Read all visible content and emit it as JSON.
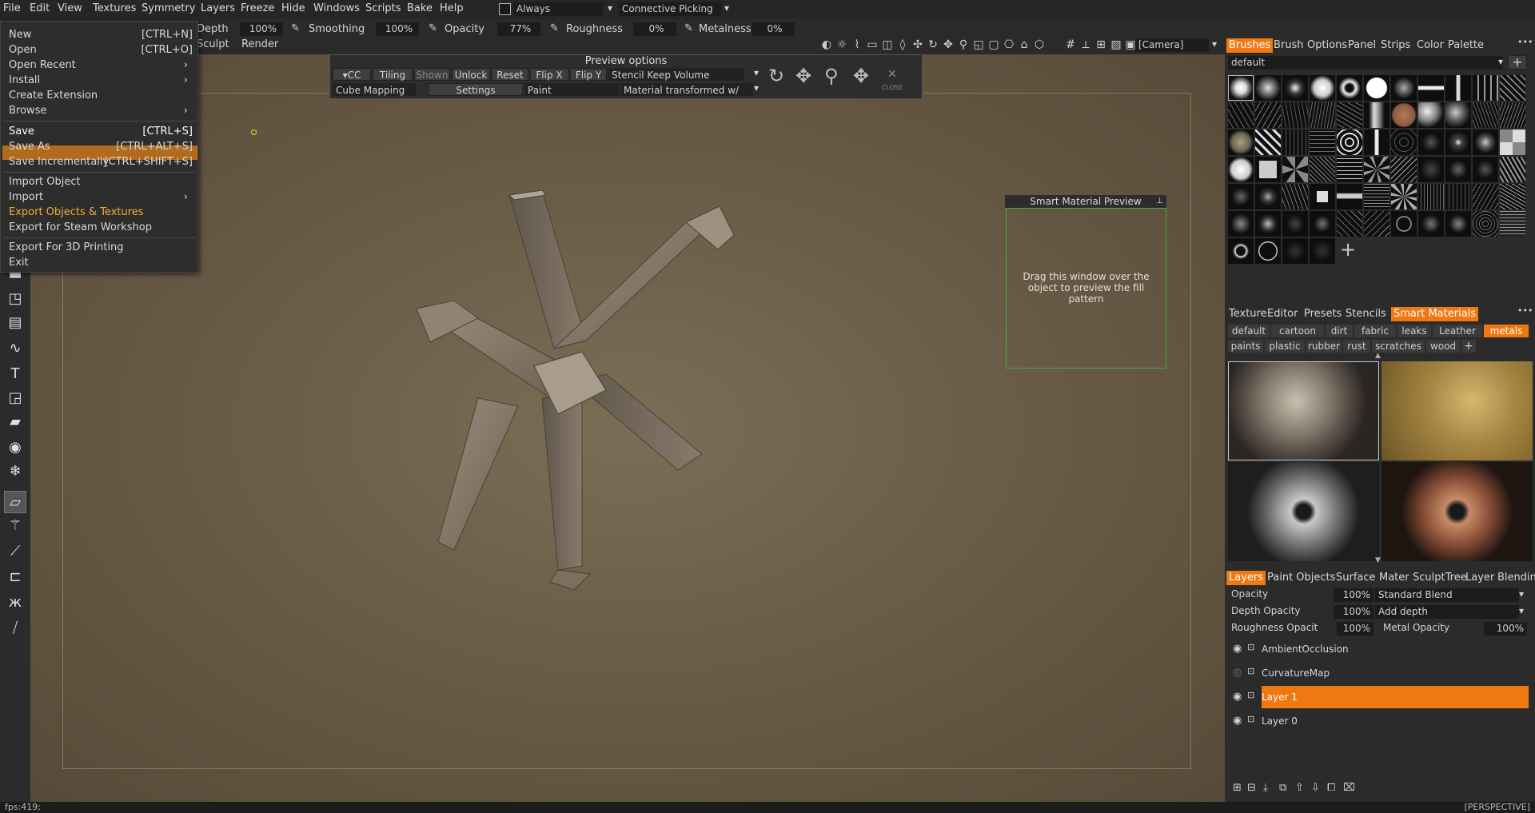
{
  "menu": [
    "File",
    "Edit",
    "View",
    "Textures",
    "Symmetry",
    "Layers",
    "Freeze",
    "Hide",
    "Windows",
    "Scripts",
    "Bake",
    "Help"
  ],
  "topbar": {
    "always": "Always",
    "picking": "Connective Picking",
    "camera": "[Camera]"
  },
  "toolbar": {
    "depth_label": "Depth",
    "depth": "100%",
    "smoothing_label": "Smoothing",
    "smoothing": "100%",
    "opacity_label": "Opacity",
    "opacity": "77%",
    "roughness_label": "Roughness",
    "roughness": "0%",
    "metalness_label": "Metalness",
    "metalness": "0%",
    "sculpt": "Sculpt",
    "render": "Render"
  },
  "file_menu": [
    {
      "label": "New",
      "shortcut": "[CTRL+N]"
    },
    {
      "label": "Open",
      "shortcut": "[CTRL+O]"
    },
    {
      "label": "Open Recent",
      "arrow": "›"
    },
    {
      "label": "Install",
      "arrow": "›"
    },
    {
      "label": "Create Extension"
    },
    {
      "label": "Browse",
      "arrow": "›"
    },
    {
      "label": "Save",
      "shortcut": "[CTRL+S]"
    },
    {
      "label": "Save As",
      "shortcut": "[CTRL+ALT+S]"
    },
    {
      "label": "Save Incrementally",
      "shortcut": "[CTRL+SHIFT+S]"
    },
    {
      "label": "Import Object"
    },
    {
      "label": "Import",
      "arrow": "›"
    },
    {
      "label": "Export Objects & Textures"
    },
    {
      "label": "Export for Steam Workshop"
    },
    {
      "label": "Export For 3D Printing"
    },
    {
      "label": "Exit"
    }
  ],
  "preview": {
    "title": "Preview options",
    "cc": "CC",
    "tiling": "Tiling",
    "shown": "Shown",
    "unlock": "Unlock",
    "reset": "Reset",
    "flipx": "Flip X",
    "flipy": "Flip Y",
    "stencil": "Stencil Keep Volume",
    "cube": "Cube Mapping",
    "settings": "Settings",
    "paint": "Paint",
    "material": "Material transformed w/",
    "close": "CLOSE"
  },
  "smp": {
    "title": "Smart Material Preview",
    "body": "Drag this window over the object to preview the fill pattern"
  },
  "right": {
    "tabs1": [
      "Brushes",
      "Brush",
      "Options",
      "Panel",
      "Strips",
      "Color",
      "Palette"
    ],
    "brush_set": "default",
    "tabs2": [
      "Texture",
      "Editor",
      "Presets",
      "Stencils",
      "Smart Materials"
    ],
    "cats1": [
      "default",
      "cartoon",
      "dirt",
      "fabric",
      "leaks",
      "Leather",
      "metals"
    ],
    "cats2": [
      "paints",
      "plastic",
      "rubber",
      "rust",
      "scratches",
      "wood"
    ],
    "tabs3": [
      "Layers",
      "Paint Objects",
      "Surface",
      "Mater",
      "SculptTree",
      "Layer",
      "Blendin"
    ],
    "opacity_label": "Opacity",
    "opacity": "100%",
    "blend": "Standard Blend",
    "depth_label": "Depth Opacity",
    "depth": "100%",
    "depth_mode": "Add depth",
    "rough_label": "Roughness Opacit",
    "rough": "100%",
    "metal_label": "Metal Opacity",
    "metal": "100%",
    "layers": [
      "AmbientOcclusion",
      "CurvatureMap",
      "Layer 1",
      "Layer 0"
    ]
  },
  "status": {
    "fps": "fps:419;",
    "mode": "[PERSPECTIVE]"
  },
  "colors": {
    "accent": "#f07810",
    "selection": "#b26a1e",
    "highlight_text": "#f0b030"
  }
}
